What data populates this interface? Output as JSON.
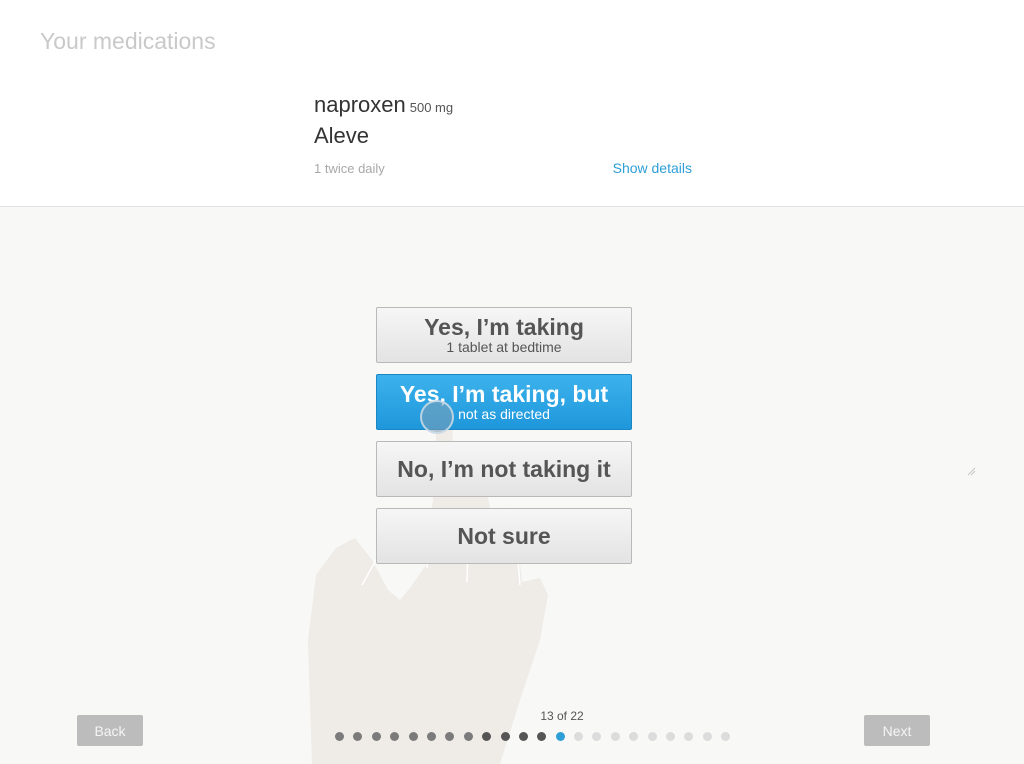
{
  "header": {
    "title": "Your medications"
  },
  "medication": {
    "generic_name": "naproxen",
    "dose": "500 mg",
    "brand_name": "Aleve",
    "schedule": "1 twice daily",
    "details_link": "Show details"
  },
  "options": [
    {
      "main": "Yes, I’m taking",
      "sub": "1 tablet at bedtime",
      "selected": false
    },
    {
      "main": "Yes, I’m taking, but",
      "sub": "not as directed",
      "selected": true
    },
    {
      "main": "No, I’m not taking it",
      "sub": "",
      "selected": false
    },
    {
      "main": "Not sure",
      "sub": "",
      "selected": false
    }
  ],
  "footer": {
    "back_label": "Back",
    "next_label": "Next",
    "progress_text": "13 of 22",
    "current_step": 13,
    "total_steps": 22
  },
  "colors": {
    "accent": "#2e9ed7",
    "button_disabled": "#bcbcbc"
  }
}
